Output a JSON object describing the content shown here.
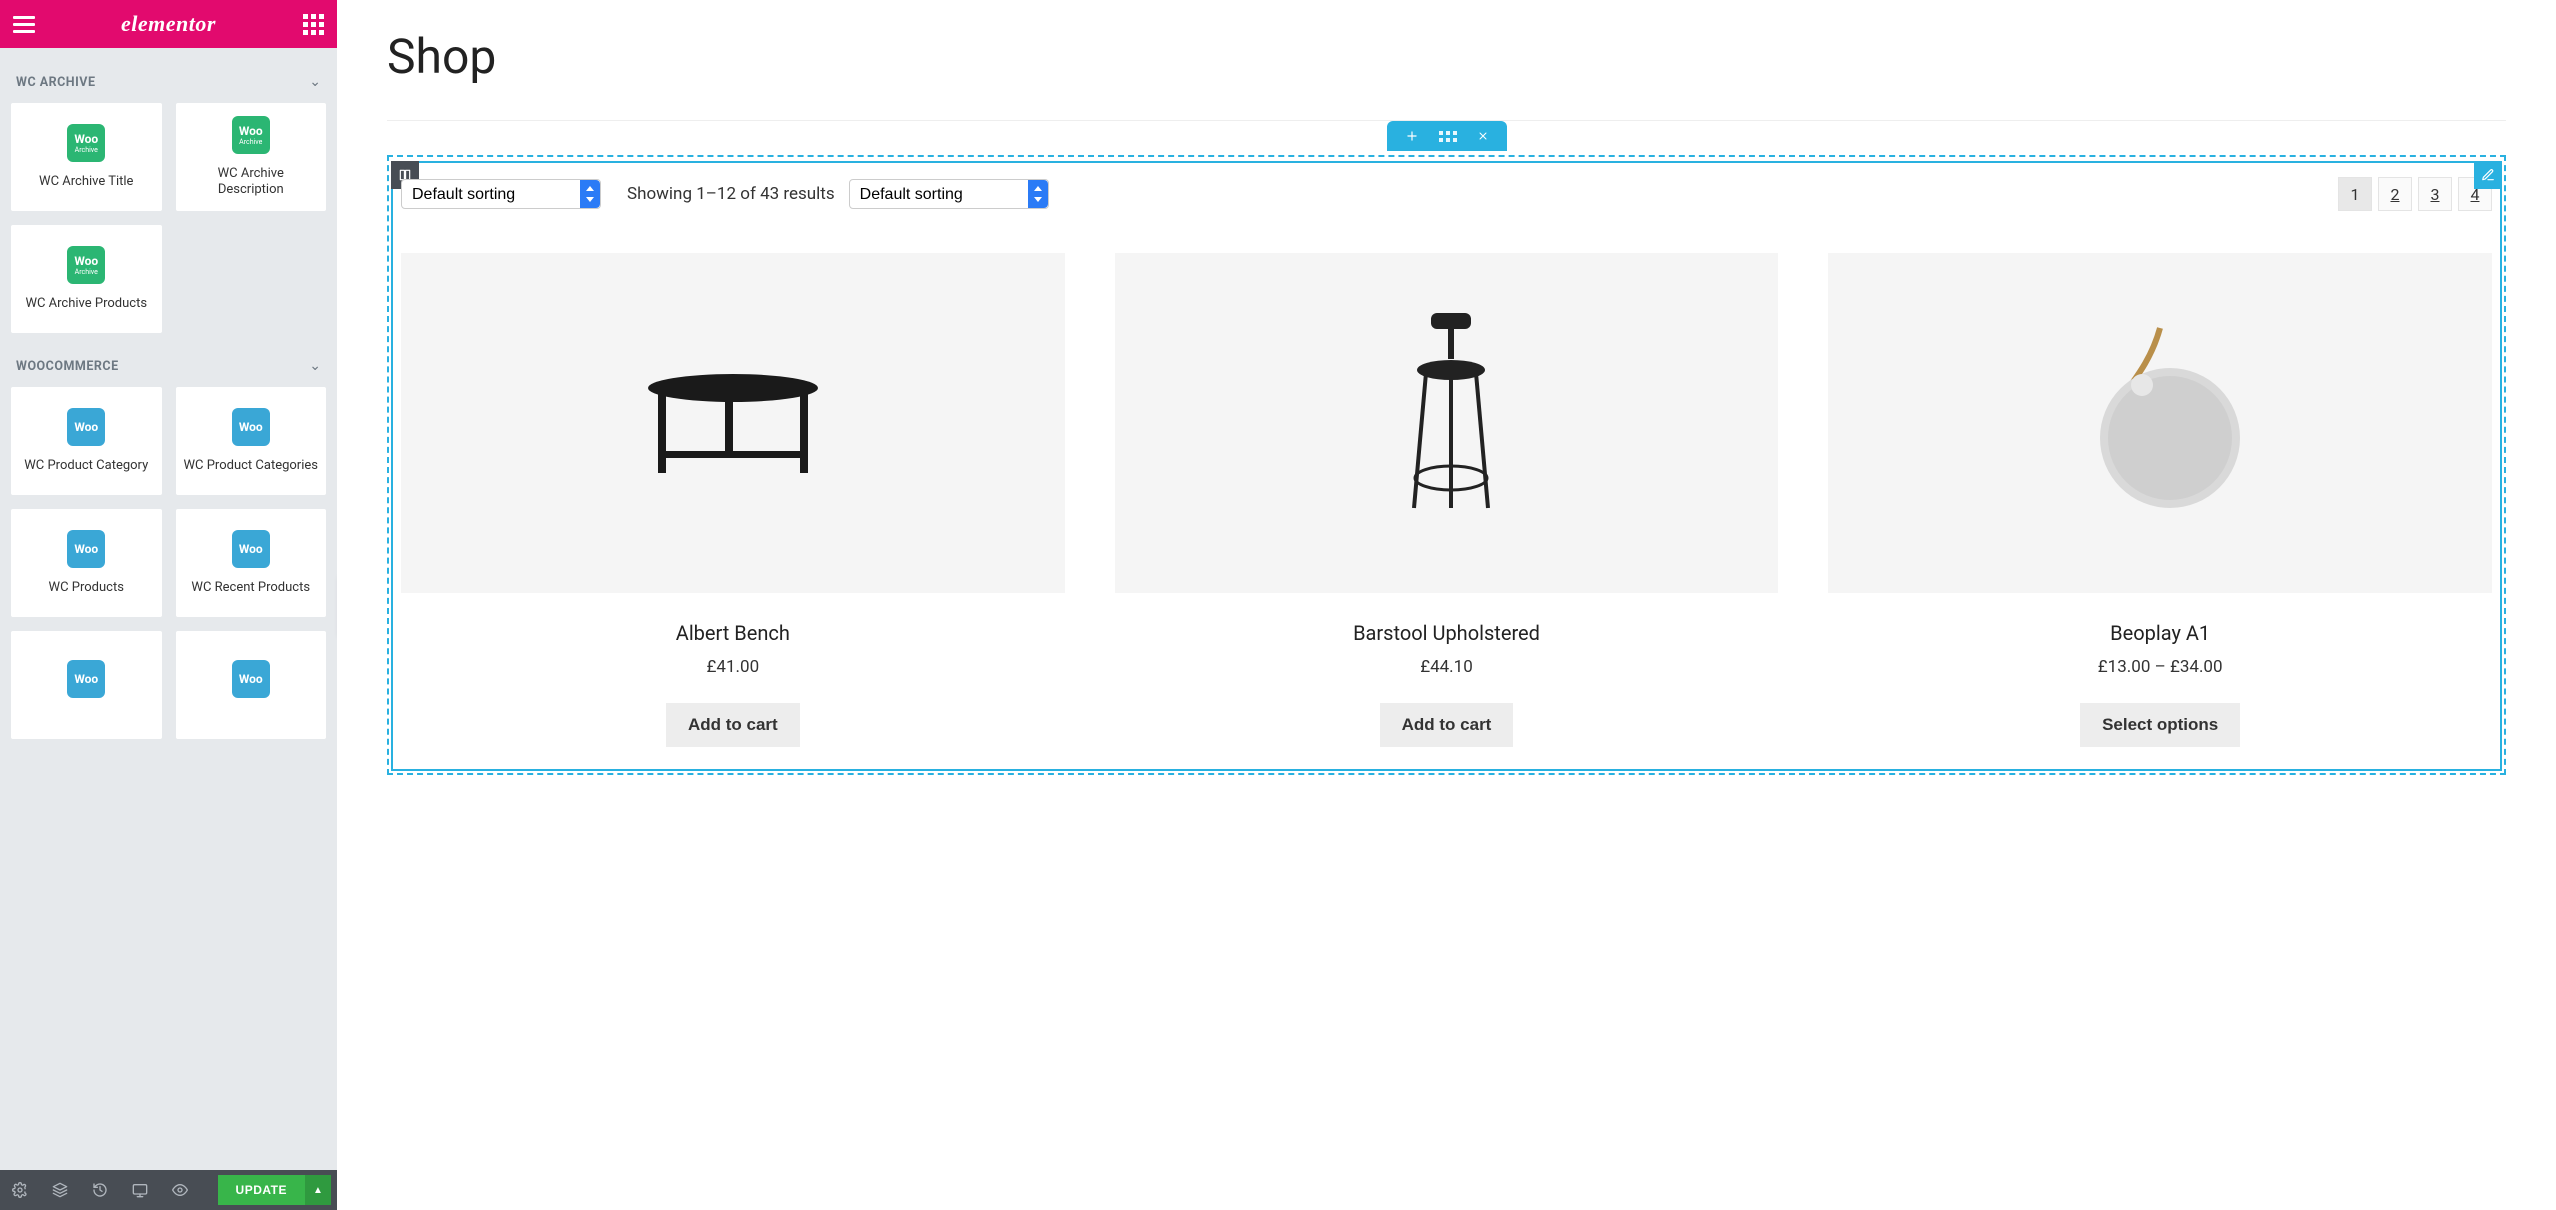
{
  "brand": "elementor",
  "sidebar": {
    "sections": [
      {
        "id": "wc_archive",
        "label": "WC ARCHIVE",
        "widgets": [
          {
            "id": "wc-archive-title",
            "name": "WC Archive Title",
            "icon_text": "Woo",
            "icon_sub": "Archive",
            "icon_color": "green"
          },
          {
            "id": "wc-archive-description",
            "name": "WC Archive Description",
            "icon_text": "Woo",
            "icon_sub": "Archive",
            "icon_color": "green"
          },
          {
            "id": "wc-archive-products",
            "name": "WC Archive Products",
            "icon_text": "Woo",
            "icon_sub": "Archive",
            "icon_color": "green"
          }
        ]
      },
      {
        "id": "woocommerce",
        "label": "WOOCOMMERCE",
        "widgets": [
          {
            "id": "wc-product-category",
            "name": "WC Product Category",
            "icon_text": "Woo",
            "icon_sub": "",
            "icon_color": "blue"
          },
          {
            "id": "wc-product-categories",
            "name": "WC Product Categories",
            "icon_text": "Woo",
            "icon_sub": "",
            "icon_color": "blue"
          },
          {
            "id": "wc-products",
            "name": "WC Products",
            "icon_text": "Woo",
            "icon_sub": "",
            "icon_color": "blue"
          },
          {
            "id": "wc-recent-products",
            "name": "WC Recent Products",
            "icon_text": "Woo",
            "icon_sub": "",
            "icon_color": "blue"
          },
          {
            "id": "wc-extra-1",
            "name": "",
            "icon_text": "Woo",
            "icon_sub": "",
            "icon_color": "blue"
          },
          {
            "id": "wc-extra-2",
            "name": "",
            "icon_text": "Woo",
            "icon_sub": "",
            "icon_color": "blue"
          }
        ]
      }
    ],
    "update_label": "UPDATE"
  },
  "main": {
    "page_title": "Shop",
    "results_text": "Showing 1–12 of 43 results",
    "sort_options": [
      "Default sorting"
    ],
    "sort_selected": "Default sorting",
    "pagination": [
      "1",
      "2",
      "3",
      "4"
    ],
    "current_page": "1",
    "products": [
      {
        "id": "albert-bench",
        "title": "Albert Bench",
        "price": "£41.00",
        "button": "Add to cart"
      },
      {
        "id": "barstool-upholstered",
        "title": "Barstool Upholstered",
        "price": "£44.10",
        "button": "Add to cart"
      },
      {
        "id": "beoplay-a1",
        "title": "Beoplay A1",
        "price": "£13.00 – £34.00",
        "button": "Select options"
      }
    ]
  }
}
